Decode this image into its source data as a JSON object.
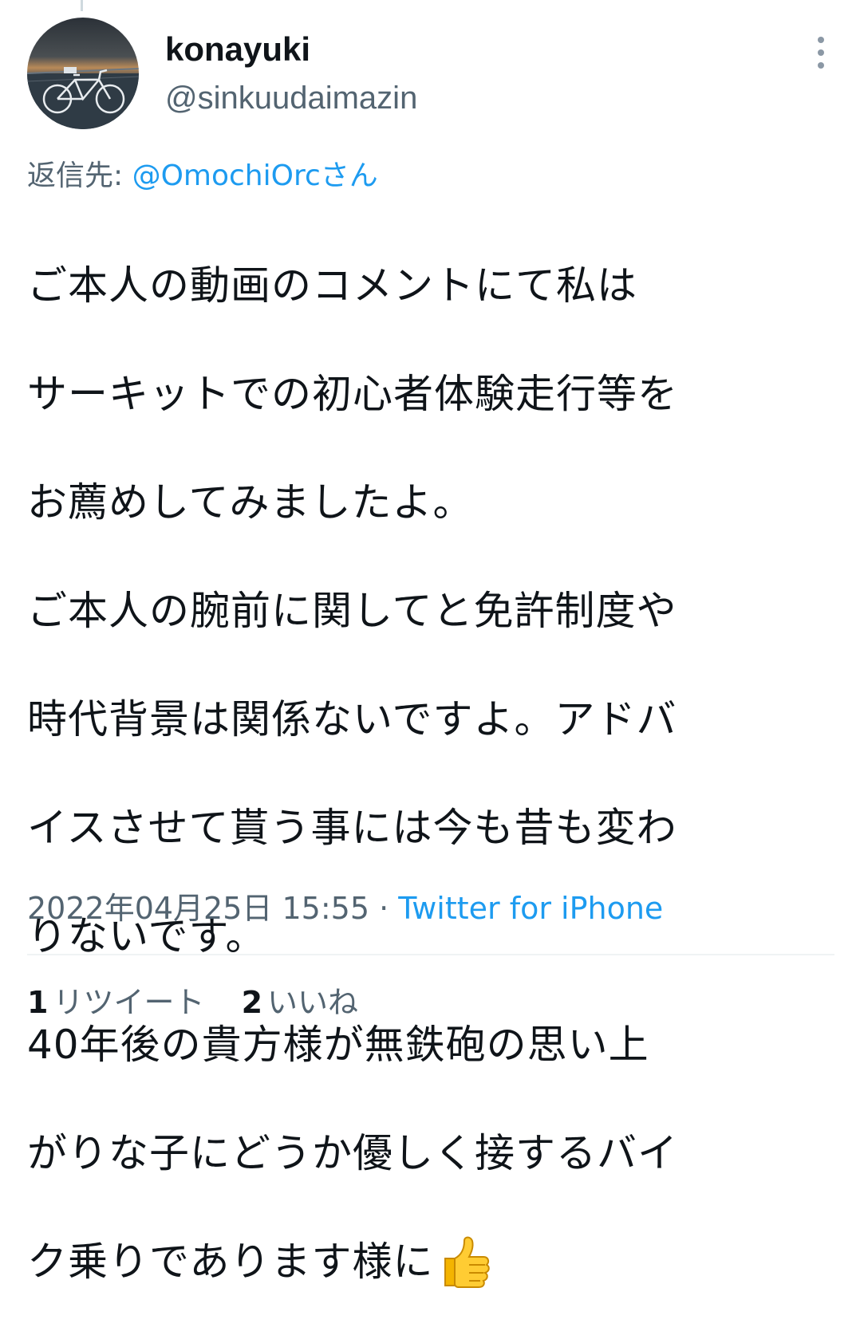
{
  "author": {
    "display_name": "konayuki",
    "handle": "@sinkuudaimazin",
    "avatar_icon": "bicycle-photo-avatar"
  },
  "reply_to": {
    "prefix": "返信先: ",
    "mention": "@OmochiOrcさん"
  },
  "tweet": {
    "text_lines": [
      "ご本人の動画のコメントにて私は",
      "サーキットでの初心者体験走行等を",
      "お薦めしてみましたよ。",
      "ご本人の腕前に関してと免許制度や",
      "時代背景は関係ないですよ。アドバ",
      "イスさせて貰う事には今も昔も変わ",
      "りないです。",
      "40年後の貴方様が無鉄砲の思い上",
      "がりな子にどうか優しく接するバイ",
      "ク乗りであります様に"
    ],
    "emoji": "thumbs-up-icon"
  },
  "meta": {
    "timestamp": "2022年04月25日 15:55",
    "separator": " · ",
    "source": "Twitter for iPhone"
  },
  "stats": {
    "retweets_count": "1",
    "retweets_label": "リツイート",
    "likes_count": "2",
    "likes_label": "いいね"
  },
  "colors": {
    "text": "#0f1419",
    "secondary": "#536471",
    "link": "#1d9bf0",
    "divider": "#eff3f4"
  }
}
